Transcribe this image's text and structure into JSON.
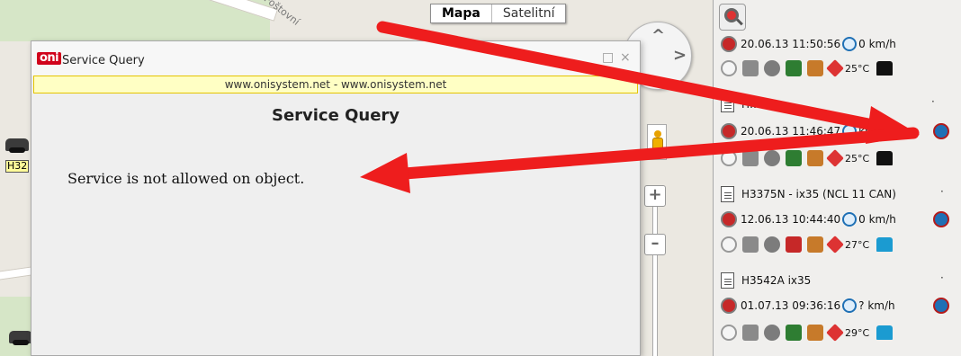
{
  "map": {
    "street_name": "Poštovní",
    "map_type_tabs": [
      "Mapa",
      "Satelitní"
    ],
    "vehicle_labels": [
      "H32",
      ""
    ]
  },
  "dialog": {
    "logo_text": "oni",
    "title": "Service Query",
    "url_bar": "www.onisystem.net - www.onisystem.net",
    "heading": "Service Query",
    "message": "Service is not allowed on object."
  },
  "panel": {
    "partial_top_row": {
      "datetime": "20.06.13 11:50:56",
      "speed": "0 km/h"
    },
    "vehicles": [
      {
        "name": "H…",
        "datetime": "20.06.13 11:46:47",
        "speed": "km/h",
        "temperature": "25°C",
        "shirt_color": "#111111"
      },
      {
        "name": "H3375N - ix35 (NCL 11 CAN)",
        "datetime": "12.06.13 10:44:40",
        "speed": "0 km/h",
        "temperature": "27°C",
        "shirt_color": "#1b9bd1"
      },
      {
        "name": "H3542A ix35",
        "datetime": "01.07.13 09:36:16",
        "speed": "? km/h",
        "temperature": "29°C",
        "shirt_color": "#1b9bd1"
      }
    ],
    "top_row_temperature": "25°C"
  },
  "annotation_color": "#ee1d1d"
}
